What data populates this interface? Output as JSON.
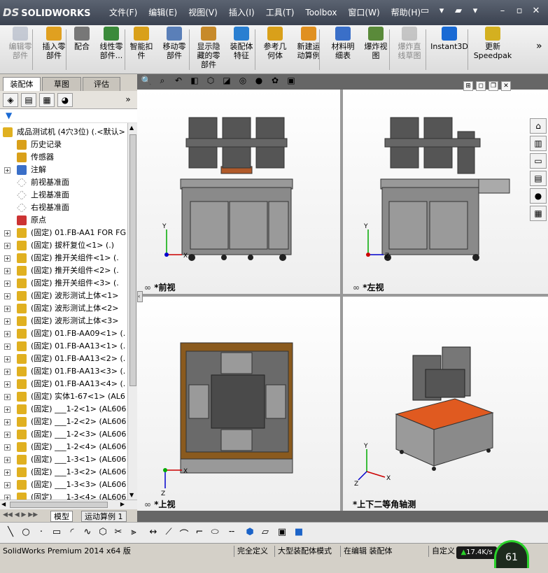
{
  "app": {
    "logo": "SOLIDWORKS",
    "logo_prefix": "DS"
  },
  "menu": [
    "文件(F)",
    "编辑(E)",
    "视图(V)",
    "插入(I)",
    "工具(T)",
    "Toolbox",
    "窗口(W)",
    "帮助(H)"
  ],
  "ribbon": [
    {
      "label": "编辑零\n部件",
      "icon": "edit-component-icon",
      "disabled": true
    },
    {
      "label": "插入零\n部件",
      "icon": "insert-component-icon",
      "disabled": false
    },
    {
      "label": "配合",
      "icon": "mate-icon",
      "disabled": false
    },
    {
      "label": "线性零\n部件...",
      "icon": "linear-pattern-icon",
      "disabled": false
    },
    {
      "label": "智能扣\n件",
      "icon": "smart-fastener-icon",
      "disabled": false
    },
    {
      "label": "移动零\n部件",
      "icon": "move-component-icon",
      "disabled": false
    },
    {
      "label": "显示隐\n藏的零\n部件",
      "icon": "show-hidden-icon",
      "disabled": false
    },
    {
      "label": "装配体\n特征",
      "icon": "assembly-feature-icon",
      "disabled": false
    },
    {
      "label": "参考几\n何体",
      "icon": "reference-geometry-icon",
      "disabled": false
    },
    {
      "label": "新建运\n动算例",
      "icon": "new-motion-study-icon",
      "disabled": false
    },
    {
      "label": "材料明\n细表",
      "icon": "bom-icon",
      "disabled": false
    },
    {
      "label": "爆炸视\n图",
      "icon": "exploded-view-icon",
      "disabled": false
    },
    {
      "label": "爆炸直\n线草图",
      "icon": "explode-line-icon",
      "disabled": true
    },
    {
      "label": "Instant3D",
      "icon": "instant3d-icon",
      "disabled": false
    },
    {
      "label": "更新\nSpeedpak",
      "icon": "speedpak-icon",
      "disabled": false
    }
  ],
  "left_tabs": [
    "装配体",
    "草图",
    "评估"
  ],
  "tree": {
    "root": "成品测试机 (4穴3位)  (.<默认>",
    "items": [
      {
        "text": "历史记录",
        "icon": "history-icon",
        "expandable": false
      },
      {
        "text": "传感器",
        "icon": "sensor-icon",
        "expandable": false
      },
      {
        "text": "注解",
        "icon": "annotation-icon",
        "expandable": true
      },
      {
        "text": "前视基准面",
        "icon": "plane-icon",
        "expandable": false
      },
      {
        "text": "上视基准面",
        "icon": "plane-icon",
        "expandable": false
      },
      {
        "text": "右视基准面",
        "icon": "plane-icon",
        "expandable": false
      },
      {
        "text": "原点",
        "icon": "origin-icon",
        "expandable": false
      },
      {
        "text": "(固定) 01.FB-AA1 FOR FG",
        "icon": "part-icon",
        "expandable": true
      },
      {
        "text": "(固定) 拔杆复位<1> (.)",
        "icon": "part-icon",
        "expandable": true
      },
      {
        "text": "(固定) 推开关组件<1> (.",
        "icon": "part-icon",
        "expandable": true
      },
      {
        "text": "(固定) 推开关组件<2> (.",
        "icon": "part-icon",
        "expandable": true
      },
      {
        "text": "(固定) 推开关组件<3> (.",
        "icon": "part-icon",
        "expandable": true
      },
      {
        "text": "(固定) 波形测试上体<1>",
        "icon": "part-icon",
        "expandable": true
      },
      {
        "text": "(固定) 波形测试上体<2>",
        "icon": "part-icon",
        "expandable": true
      },
      {
        "text": "(固定) 波形测试上体<3>",
        "icon": "part-icon",
        "expandable": true
      },
      {
        "text": "(固定) 01.FB-AA09<1> (.",
        "icon": "part-icon",
        "expandable": true
      },
      {
        "text": "(固定) 01.FB-AA13<1> (.",
        "icon": "part-icon",
        "expandable": true
      },
      {
        "text": "(固定) 01.FB-AA13<2> (.",
        "icon": "part-icon",
        "expandable": true
      },
      {
        "text": "(固定) 01.FB-AA13<3> (.",
        "icon": "part-icon",
        "expandable": true
      },
      {
        "text": "(固定) 01.FB-AA13<4> (.",
        "icon": "part-icon",
        "expandable": true
      },
      {
        "text": "(固定) 实体1-67<1> (AL6",
        "icon": "part-icon",
        "expandable": true
      },
      {
        "text": "(固定) ___1-2<1> (AL606",
        "icon": "part-icon",
        "expandable": true
      },
      {
        "text": "(固定) ___1-2<2> (AL606",
        "icon": "part-icon",
        "expandable": true
      },
      {
        "text": "(固定) ___1-2<3> (AL606",
        "icon": "part-icon",
        "expandable": true
      },
      {
        "text": "(固定) ___1-2<4> (AL606",
        "icon": "part-icon",
        "expandable": true
      },
      {
        "text": "(固定) ___1-3<1> (AL606",
        "icon": "part-icon",
        "expandable": true
      },
      {
        "text": "(固定) ___1-3<2> (AL606",
        "icon": "part-icon",
        "expandable": true
      },
      {
        "text": "(固定) ___1-3<3> (AL606",
        "icon": "part-icon",
        "expandable": true
      },
      {
        "text": "(固定) ___1-3<4> (AL606",
        "icon": "part-icon",
        "expandable": true
      }
    ]
  },
  "bottom_tabs": [
    "模型",
    "运动算例 1"
  ],
  "views": {
    "front": "*前视",
    "left": "*左视",
    "top": "*上视",
    "iso": "*上下二等角轴测"
  },
  "status": {
    "app": "SolidWorks Premium 2014 x64 版",
    "s1": "完全定义",
    "s2": "大型装配体模式",
    "s3": "在编辑 装配体",
    "s4": "自定义",
    "speed": "17.4K/s",
    "gauge": "61"
  },
  "colors": {
    "frame": "#5a5a5a",
    "base_orange": "#8a5a1e",
    "accent_green": "#2ad12a"
  }
}
